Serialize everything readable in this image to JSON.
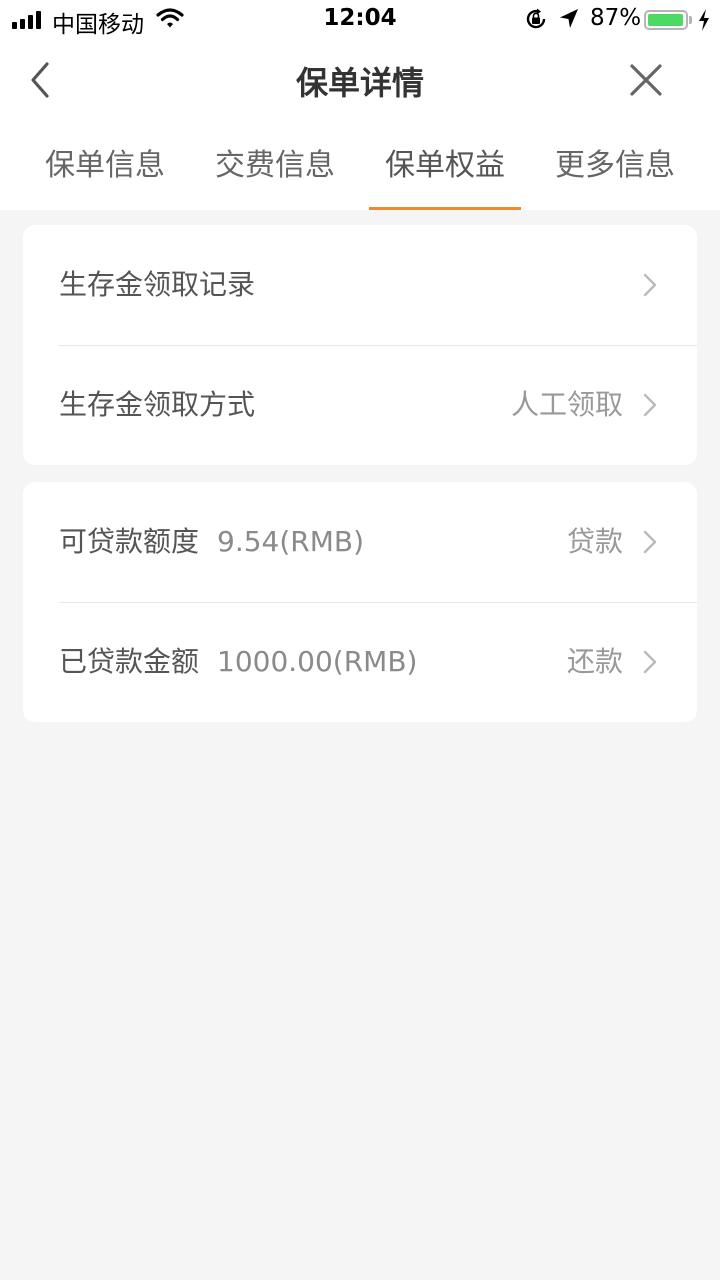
{
  "status_bar": {
    "carrier": "中国移动",
    "time": "12:04",
    "battery_percent": "87%",
    "battery_level": 0.87,
    "icons": [
      "signal-icon",
      "wifi-icon",
      "rotation-lock-icon",
      "location-icon",
      "battery-icon",
      "charging-icon"
    ]
  },
  "nav": {
    "title": "保单详情",
    "back_icon": "chevron-left-icon",
    "close_icon": "close-icon"
  },
  "tabs": [
    {
      "label": "保单信息",
      "active": false
    },
    {
      "label": "交费信息",
      "active": false
    },
    {
      "label": "保单权益",
      "active": true
    },
    {
      "label": "更多信息",
      "active": false
    }
  ],
  "accent_color": "#f08a30",
  "survival_card": {
    "rows": [
      {
        "label": "生存金领取记录",
        "value": ""
      },
      {
        "label": "生存金领取方式",
        "value": "人工领取"
      }
    ]
  },
  "loan_card": {
    "rows": [
      {
        "label": "可贷款额度",
        "amount": "9.54(RMB)",
        "action": "贷款"
      },
      {
        "label": "已贷款金额",
        "amount": "1000.00(RMB)",
        "action": "还款"
      }
    ]
  }
}
